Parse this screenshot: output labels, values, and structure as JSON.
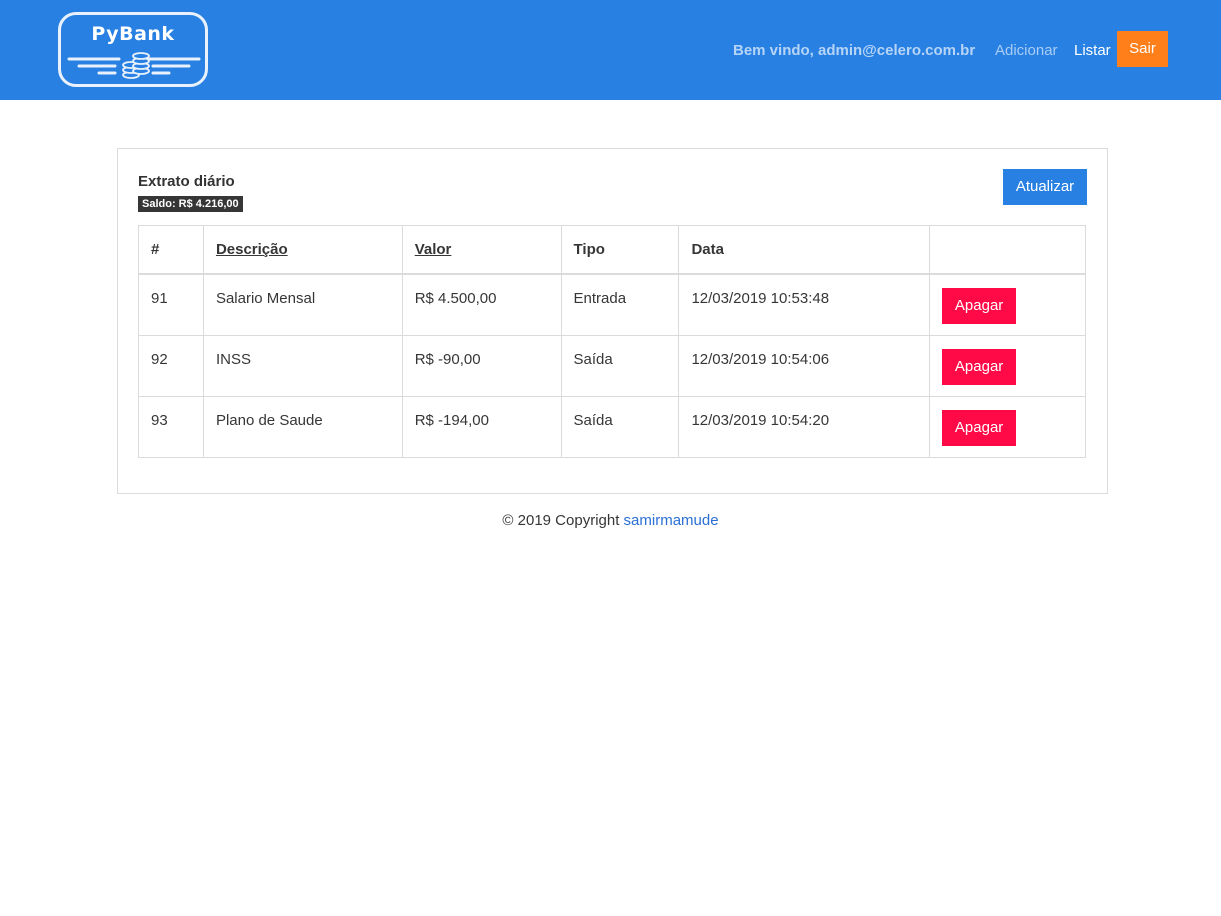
{
  "brand": {
    "name": "PyBank",
    "icon": "coins-stack-icon"
  },
  "header": {
    "welcome": "Bem vindo, admin@celero.com.br",
    "nav_add": "Adicionar",
    "nav_list": "Listar",
    "logout": "Sair"
  },
  "colors": {
    "navbar": "#2880e3",
    "logout_button": "#ff7f1b",
    "update_button": "#2880e3",
    "delete_button": "#ff0a47",
    "badge": "#363636",
    "link": "#2a6fd6"
  },
  "statement": {
    "title": "Extrato diário",
    "balance": "Saldo: R$ 4.216,00",
    "update_button": "Atualizar",
    "columns": [
      "#",
      "Descrição",
      "Valor",
      "Tipo",
      "Data",
      ""
    ],
    "rows": [
      {
        "id": "91",
        "description": "Salario Mensal",
        "value": "R$ 4.500,00",
        "type": "Entrada",
        "date": "12/03/2019 10:53:48",
        "action": "Apagar"
      },
      {
        "id": "92",
        "description": "INSS",
        "value": "R$ -90,00",
        "type": "Saída",
        "date": "12/03/2019 10:54:06",
        "action": "Apagar"
      },
      {
        "id": "93",
        "description": "Plano de Saude",
        "value": "R$ -194,00",
        "type": "Saída",
        "date": "12/03/2019 10:54:20",
        "action": "Apagar"
      }
    ]
  },
  "footer": {
    "copyright": "© 2019 Copyright",
    "author": "samirmamude"
  }
}
